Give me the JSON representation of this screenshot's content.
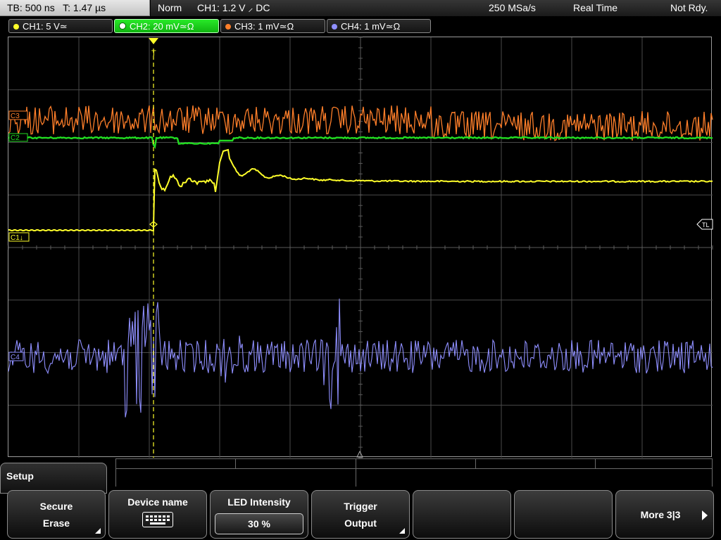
{
  "status": {
    "timebase": "TB: 500 ns",
    "trigger_time": "T: 1.47 µs",
    "mode": "Norm",
    "trigger_source": "CH1: 1.2 V",
    "trigger_slope": "⸝",
    "trigger_coupling": "DC",
    "sample_rate": "250 MSa/s",
    "acq_mode": "Real Time",
    "state": "Not Rdy."
  },
  "channels": [
    {
      "label": "CH1: 5 V",
      "suffix": "≃",
      "color": "#ffff2a",
      "active": false
    },
    {
      "label": "CH2: 20 mV",
      "suffix": "≃Ω",
      "color": "#22dd22",
      "active": true
    },
    {
      "label": "CH3: 1 mV",
      "suffix": "≃Ω",
      "color": "#ff7f2a",
      "active": false
    },
    {
      "label": "CH4: 1 mV",
      "suffix": "≃Ω",
      "color": "#8f8fff",
      "active": false
    }
  ],
  "markers": {
    "ch1": "C1↓",
    "ch2": "C2",
    "ch3": "C3",
    "ch4": "C4",
    "trigger_level": "TL",
    "trigger_pos": "T"
  },
  "menu": {
    "title": "Setup",
    "softkeys": [
      {
        "line1": "Secure",
        "line2": "Erase",
        "has_submenu": true
      },
      {
        "line1": "Device name",
        "icon": "keyboard-icon"
      },
      {
        "line1": "LED Intensity",
        "value": "30 %"
      },
      {
        "line1": "Trigger",
        "line2": "Output",
        "has_submenu": true
      },
      {
        "line1": ""
      },
      {
        "line1": ""
      },
      {
        "line1": "More 3|3",
        "icon": "arrow-right-icon"
      }
    ]
  },
  "colors": {
    "ch1": "#ffff2a",
    "ch2": "#22dd22",
    "ch3": "#ff7f2a",
    "ch4": "#8f8fff",
    "grid": "#4a4a4a"
  }
}
